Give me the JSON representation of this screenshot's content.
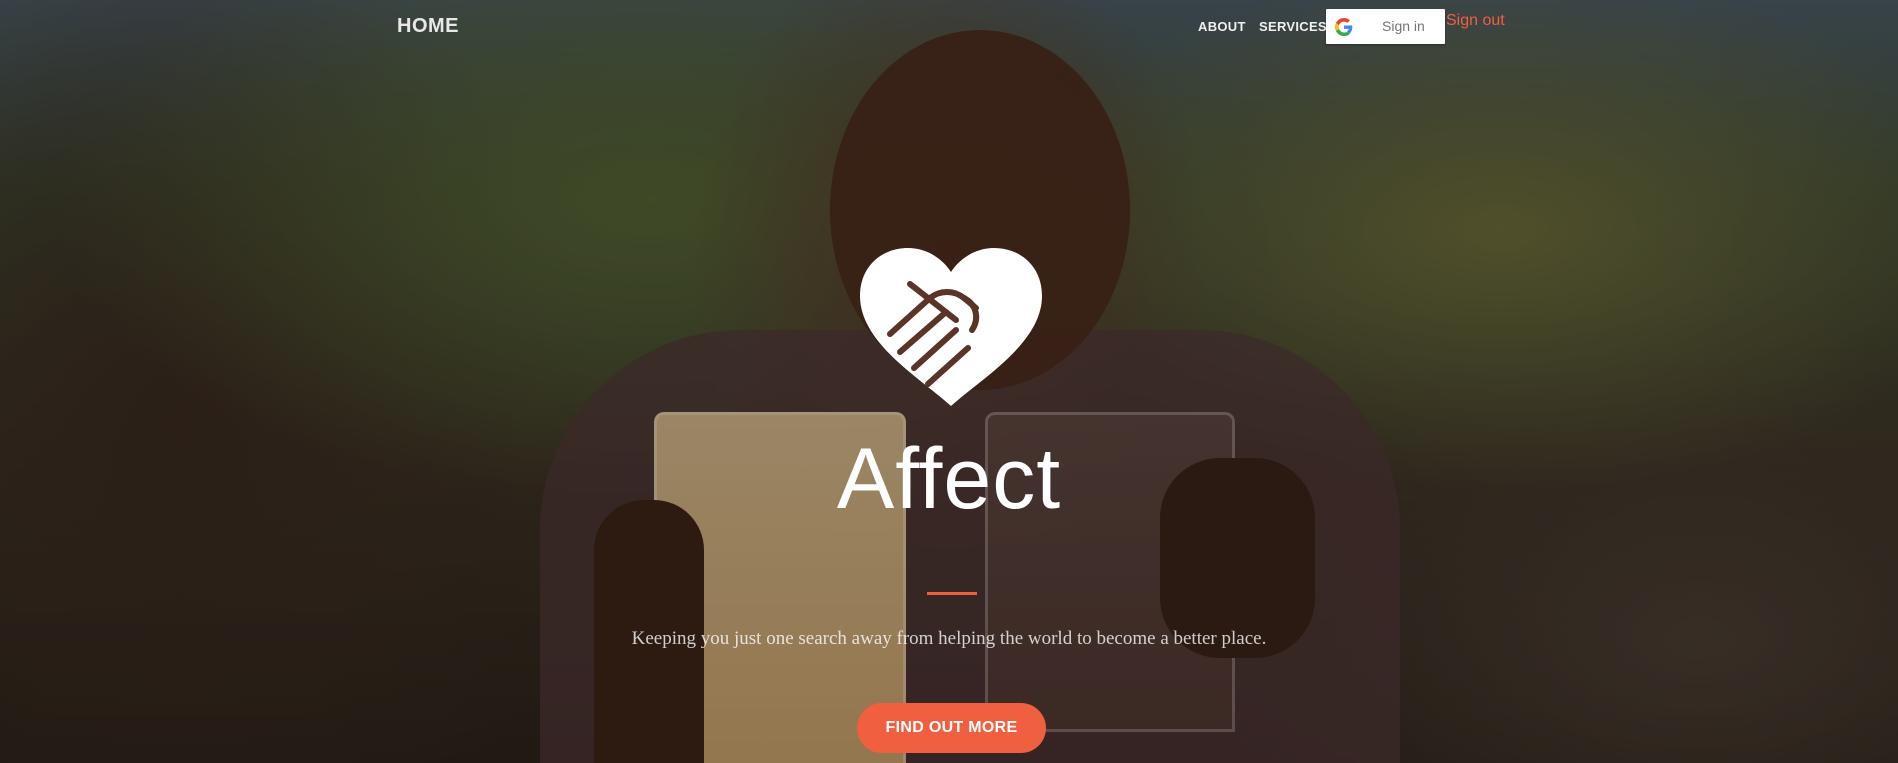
{
  "nav": {
    "brand": "HOME",
    "links": [
      {
        "label": "ABOUT"
      },
      {
        "label": "SERVICES"
      }
    ],
    "google_signin_label": "Sign in",
    "signout_label": "Sign out"
  },
  "hero": {
    "logo_icon": "heart-handshake-icon",
    "title": "Affect",
    "subtitle": "Keeping you just one search away from helping the world to become a better place.",
    "cta_label": "FIND OUT MORE"
  },
  "colors": {
    "accent": "#f05f40",
    "title_text": "#ffffff",
    "signin_bg": "#ffffff"
  }
}
